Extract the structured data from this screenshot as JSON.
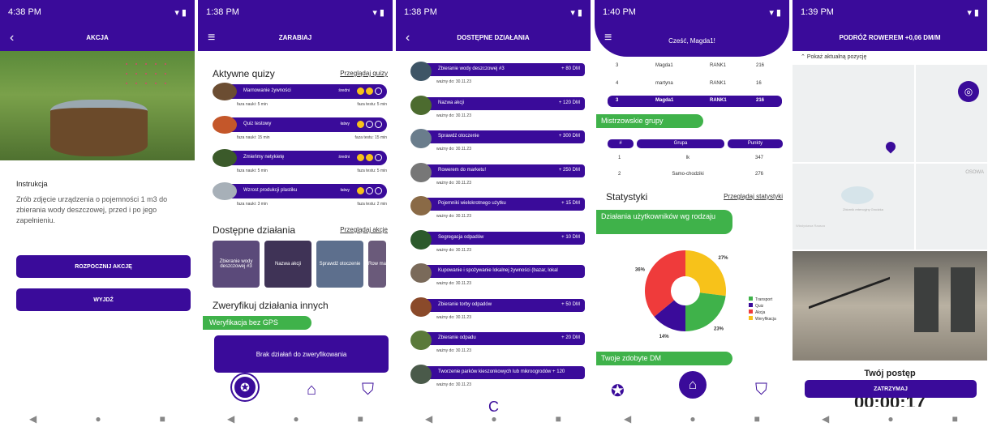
{
  "colors": {
    "primary": "#3a0b9a",
    "accent_green": "#3fb24a",
    "bubble_yellow": "#f7c21a"
  },
  "screen1": {
    "time": "4:38 PM",
    "title": "AKCJA",
    "instruction_label": "Instrukcja",
    "instruction_text": "Zrób zdjęcie urządzenia o pojemności 1 m3 do zbierania wody deszczowej, przed i po jego zapełnieniu.",
    "start_button": "ROZPOCZNIJ AKCJĘ",
    "exit_button": "WYJDŹ"
  },
  "screen2": {
    "time": "1:38 PM",
    "title": "ZARABIAJ",
    "active_quizzes": "Aktywne quizy",
    "browse_quizzes": "Przeglądaj quizy",
    "quizzes": [
      {
        "name": "Marnowanie żywności",
        "level": "średni",
        "filled": 2,
        "learn": "faza nauki: 5 min",
        "test": "faza testu: 5 min"
      },
      {
        "name": "Quiz testowy",
        "level": "łatwy",
        "filled": 1,
        "learn": "faza nauki: 15 min",
        "test": "faza testu: 15 min"
      },
      {
        "name": "Zmieńmy netykietę",
        "level": "średni",
        "filled": 2,
        "learn": "faza nauki: 5 min",
        "test": "faza testu: 5 min"
      },
      {
        "name": "Wzrost produkcji plastiku",
        "level": "łatwy",
        "filled": 1,
        "learn": "faza nauki: 3 min",
        "test": "faza testu: 2 min"
      }
    ],
    "available_actions": "Dostępne działania",
    "browse_actions": "Przeglądaj akcje",
    "action_tiles": [
      "Zbieranie wody deszczowej #3",
      "Nazwa akcji",
      "Sprawdź otoczenie",
      "Row ma"
    ],
    "verify_heading": "Zweryfikuj działania innych",
    "verify_tab": "Weryfikacja bez GPS",
    "empty_verify": "Brak działań do zweryfikowania"
  },
  "screen3": {
    "time": "1:38 PM",
    "title": "DOSTĘPNE DZIAŁANIA",
    "items": [
      {
        "name": "Zbieranie wody deszczowej #3",
        "points": "+ 80 DM",
        "date": "ważny do: 30.11.23"
      },
      {
        "name": "Nazwa akcji",
        "points": "+ 120 DM",
        "date": "ważny do: 30.11.23"
      },
      {
        "name": "Sprawdź otoczenie",
        "points": "+ 300 DM",
        "date": "ważny do: 30.11.23"
      },
      {
        "name": "Rowerem do marketu!",
        "points": "+ 250 DM",
        "date": "ważny do: 30.11.23"
      },
      {
        "name": "Pojemniki wielokrotnego użytku",
        "points": "+ 15 DM",
        "date": "ważny do: 30.11.23"
      },
      {
        "name": "Segregacja odpadów",
        "points": "+ 10 DM",
        "date": "ważny do: 30.11.23"
      },
      {
        "name": "Kupowanie i spożywanie lokalnej żywności (bazar, lokal",
        "points": "",
        "date": "ważny do: 30.11.23"
      },
      {
        "name": "Zbieranie torby odpadów",
        "points": "+ 50 DM",
        "date": "ważny do: 30.11.23"
      },
      {
        "name": "Zbieranie odpadu",
        "points": "+ 20 DM",
        "date": "ważny do: 30.11.23"
      },
      {
        "name": "Tworzenie parków kieszonkowych lub mikroogrodów + 120",
        "points": "",
        "date": "ważny do: 30.11.23"
      }
    ]
  },
  "screen4": {
    "time": "1:40 PM",
    "title": "Cześć, Magda1!",
    "ranking": [
      {
        "pos": "3",
        "name": "Magda1",
        "rank": "RANK1",
        "score": "216"
      },
      {
        "pos": "4",
        "name": "martyna",
        "rank": "RANK1",
        "score": "16"
      }
    ],
    "my_rank": {
      "pos": "3",
      "name": "Magda1",
      "rank": "RANK1",
      "score": "216"
    },
    "master_groups": "Mistrzowskie grupy",
    "group_headers": [
      "#",
      "Grupa",
      "Punkty"
    ],
    "groups": [
      {
        "pos": "1",
        "name": "lk",
        "points": "347"
      },
      {
        "pos": "2",
        "name": "Samo-chodziki",
        "points": "276"
      }
    ],
    "stats": "Statystyki",
    "browse_stats": "Przeglądaj statystyki",
    "stats_tab": "Działania użytkowników wg rodzaju",
    "earned_tab": "Twoje zdobyte DM"
  },
  "chart_data": {
    "type": "pie",
    "categories": [
      "Transport",
      "Quiz",
      "Akcja",
      "Weryfikacja"
    ],
    "values": [
      23,
      14,
      36,
      27
    ],
    "colors": [
      "#3fb24a",
      "#3a0b9a",
      "#ef3b3b",
      "#f7c21a"
    ],
    "labels": [
      "23%",
      "14%",
      "36%",
      "27%"
    ],
    "legend": "right"
  },
  "screen5": {
    "time": "1:39 PM",
    "title": "PODRÓŻ ROWEREM +0,06 DM/M",
    "show_position": "Pokaż aktualną pozycję",
    "map_labels": [
      "OSOWA",
      "Zbiornik retencyjny Grodzka",
      "Władysława Raasza"
    ],
    "progress": "Twój postęp",
    "stop_button": "ZATRZYMAJ",
    "timer": "00:00:17"
  }
}
